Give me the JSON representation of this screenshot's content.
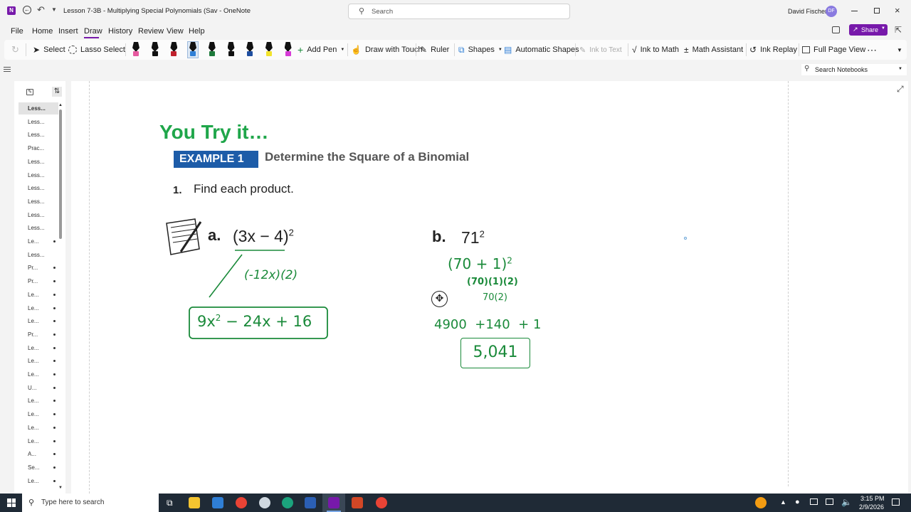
{
  "window": {
    "doc_title": "Lesson 7-3B - Multiplying Special Polynomials (Sav",
    "app_name": "OneNote",
    "search_placeholder": "Search",
    "user_name": "David Fischer",
    "user_initials": "DF"
  },
  "menu": {
    "items": [
      "File",
      "Home",
      "Insert",
      "Draw",
      "History",
      "Review",
      "View",
      "Help"
    ],
    "active": "Draw",
    "share_label": "Share"
  },
  "ribbon": {
    "select": "Select",
    "lasso": "Lasso Select",
    "add_pen": "Add Pen",
    "draw_touch": "Draw with Touch",
    "ruler": "Ruler",
    "shapes": "Shapes",
    "auto_shapes": "Automatic Shapes",
    "ink_to_text": "Ink to Text",
    "ink_to_math": "Ink to Math",
    "math_assistant": "Math Assistant",
    "ink_replay": "Ink Replay",
    "full_page": "Full Page View",
    "more": "⋯",
    "pen_colors": [
      "#e65aa0",
      "#111111",
      "#c0222e",
      "#2f7fd6",
      "#1d7a3a",
      "#111111",
      "#1f4fa0",
      "#f2e32c",
      "#d63bd6"
    ]
  },
  "search_notebooks": "Search Notebooks",
  "pages": {
    "items": [
      {
        "label": "Less...",
        "dot": false,
        "selected": true
      },
      {
        "label": "Less...",
        "dot": false
      },
      {
        "label": "Less...",
        "dot": false
      },
      {
        "label": "Prac...",
        "dot": false
      },
      {
        "label": "Less...",
        "dot": false
      },
      {
        "label": "Less...",
        "dot": false
      },
      {
        "label": "Less...",
        "dot": false
      },
      {
        "label": "Less...",
        "dot": false
      },
      {
        "label": "Less...",
        "dot": false
      },
      {
        "label": "Less...",
        "dot": false
      },
      {
        "label": "Le...",
        "dot": true
      },
      {
        "label": "Less...",
        "dot": false
      },
      {
        "label": "Pr...",
        "dot": true
      },
      {
        "label": "Pr...",
        "dot": true
      },
      {
        "label": "Le...",
        "dot": true
      },
      {
        "label": "Le...",
        "dot": true
      },
      {
        "label": "Le...",
        "dot": true
      },
      {
        "label": "Pr...",
        "dot": true
      },
      {
        "label": "Le...",
        "dot": true
      },
      {
        "label": "Le...",
        "dot": true
      },
      {
        "label": "Le...",
        "dot": true
      },
      {
        "label": "U...",
        "dot": true
      },
      {
        "label": "Le...",
        "dot": true
      },
      {
        "label": "Le...",
        "dot": true
      },
      {
        "label": "Le...",
        "dot": true
      },
      {
        "label": "Le...",
        "dot": true
      },
      {
        "label": "A...",
        "dot": true
      },
      {
        "label": "Se...",
        "dot": true
      },
      {
        "label": "Le...",
        "dot": true
      }
    ]
  },
  "note": {
    "heading": "You Try it…",
    "example_badge": "EXAMPLE 1",
    "example_title": "Determine the Square of a Binomial",
    "problem_num": "1.",
    "problem_text": "Find each product.",
    "part_a_label": "a.",
    "part_a_expr": "(3x − 4)",
    "part_a_exp": "2",
    "part_b_label": "b.",
    "part_b_expr": "71",
    "part_b_exp": "2"
  },
  "ink": {
    "a_middle": "(-12x)(2)",
    "a_answer_1": "9x",
    "a_answer_sup": "2",
    "a_answer_2": " − 24x + 16",
    "b_line1": "(70 + 1)",
    "b_line1_sup": "2",
    "b_line2": "(70)(1)(2)",
    "b_line3": "70(2)",
    "b_line4": "4900  +140  + 1",
    "b_answer": "5,041",
    "color": "#1a8a3a"
  },
  "taskbar": {
    "search_placeholder": "Type here to search",
    "time": "3:15 PM",
    "date": "2/9/2026"
  },
  "colors": {
    "heading_green": "#1fa64a",
    "badge_blue": "#1d5ca8",
    "onenote_purple": "#7719aa"
  }
}
